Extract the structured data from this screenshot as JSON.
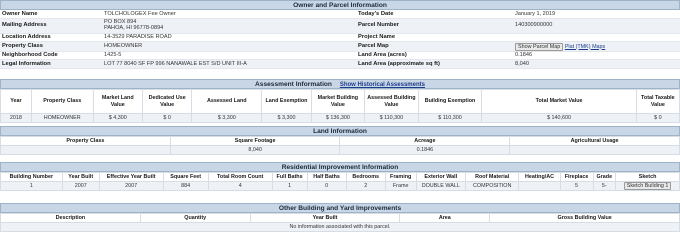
{
  "owner_section": {
    "header": "Owner and Parcel Information",
    "rows": [
      {
        "l1": "Owner Name",
        "v1": "TOLCHOLOGEX  Fee Owner",
        "l2": "Today's Date",
        "v2": "January 1, 2019"
      },
      {
        "l1": "Mailing Address",
        "v1": "PO BOX 894",
        "v1b": "PAHOA, HI 96778-0894",
        "l2": "Parcel Number",
        "v2": "140300900000"
      },
      {
        "l1": "Location Address",
        "v1": "14-3529 PARADISE ROAD",
        "l2": "Project Name",
        "v2": ""
      },
      {
        "l1": "Property Class",
        "v1": "HOMEOWNER",
        "l2": "Parcel Map",
        "v2": ""
      },
      {
        "l1": "Neighborhood Code",
        "v1": "1425-5",
        "l2": "Land Area (acres)",
        "v2": "0.1846"
      },
      {
        "l1": "Legal Information",
        "v1": "LOT 77 8040 SF FP 996 NANAWALE EST S/D UNIT III-A",
        "l2": "Land Area (approximate sq ft)",
        "v2": "8,040"
      }
    ],
    "parcel_map_button": "Show Parcel Map",
    "parcel_map_link": "Plat (TMK) Maps"
  },
  "assessment": {
    "header": "Assessment Information",
    "history_link": "Show Historical Assessments",
    "columns": [
      "Year",
      "Property Class",
      "Market Land Value",
      "Dedicated Use Value",
      "Assessed Land",
      "Land Exemption",
      "Market Building Value",
      "Assessed Building Value",
      "Building Exemption",
      "Total Market Value",
      "Total Taxable Value"
    ],
    "rows": [
      [
        "2018",
        "HOMEOWNER",
        "$ 4,300",
        "$ 0",
        "$ 3,300",
        "$ 3,300",
        "$ 136,300",
        "$ 110,300",
        "$ 110,300",
        "$ 140,600",
        "$ 0"
      ]
    ]
  },
  "land": {
    "header": "Land Information",
    "columns": [
      "Property Class",
      "Square Footage",
      "Acreage",
      "Agricultural Usage"
    ],
    "rows": [
      [
        "",
        "8,040",
        "0.1846",
        ""
      ]
    ]
  },
  "residential": {
    "header": "Residential Improvement Information",
    "columns": [
      "Building Number",
      "Year Built",
      "Effective Year Built",
      "Square Feet",
      "Total Room Count",
      "Full Baths",
      "Half Baths",
      "Bedrooms",
      "Framing",
      "Exterior Wall",
      "Roof Material",
      "Heating/AC",
      "Fireplace",
      "Grade",
      "Sketch"
    ],
    "rows": [
      [
        "1",
        "2007",
        "2007",
        "884",
        "4",
        "1",
        "0",
        "2",
        "Frame",
        "DOUBLE WALL",
        "COMPOSITION",
        "",
        "5",
        "5-"
      ]
    ],
    "sketch_button": "Sketch Building 1"
  },
  "other": {
    "header": "Other Building and Yard Improvements",
    "columns": [
      "Description",
      "Quantity",
      "Year Built",
      "Area",
      "Gross Building Value"
    ],
    "empty_message": "No information associated with this parcel."
  }
}
